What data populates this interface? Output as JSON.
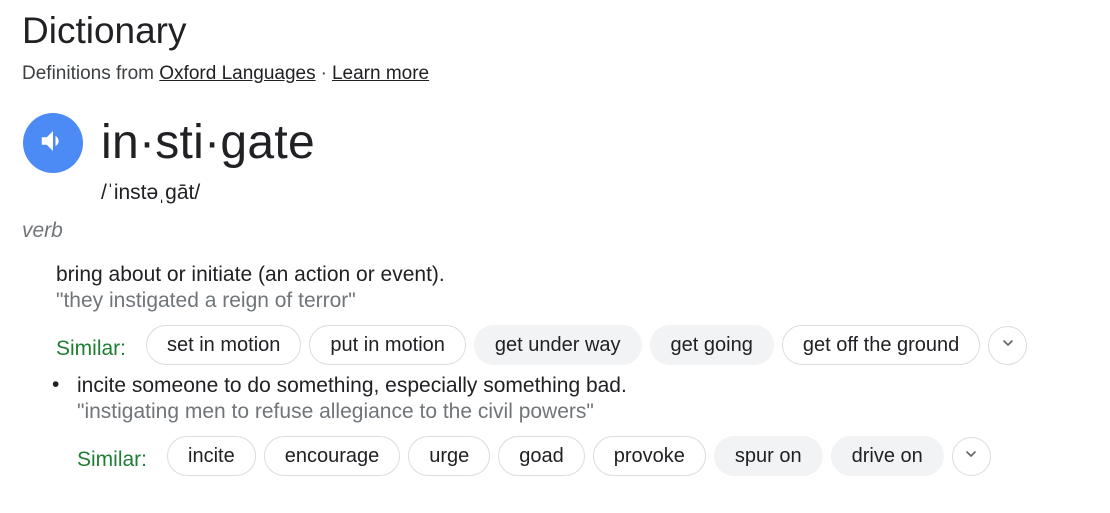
{
  "header": {
    "title": "Dictionary",
    "source_prefix": "Definitions from",
    "source_link": "Oxford Languages",
    "separator": "·",
    "learn_more": "Learn more"
  },
  "entry": {
    "word": "in·sti·gate",
    "phonetic": "/ˈinstəˌɡāt/",
    "part_of_speech": "verb"
  },
  "definitions": [
    {
      "definition": "bring about or initiate (an action or event).",
      "example": "\"they instigated a reign of terror\"",
      "similar_label": "Similar:",
      "similar": [
        {
          "label": "set in motion",
          "style": "outlined"
        },
        {
          "label": "put in motion",
          "style": "outlined"
        },
        {
          "label": "get under way",
          "style": "filled"
        },
        {
          "label": "get going",
          "style": "filled"
        },
        {
          "label": "get off the ground",
          "style": "outlined"
        }
      ]
    },
    {
      "bullet": "•",
      "definition": "incite someone to do something, especially something bad.",
      "example": "\"instigating men to refuse allegiance to the civil powers\"",
      "similar_label": "Similar:",
      "similar": [
        {
          "label": "incite",
          "style": "outlined"
        },
        {
          "label": "encourage",
          "style": "outlined"
        },
        {
          "label": "urge",
          "style": "outlined"
        },
        {
          "label": "goad",
          "style": "outlined"
        },
        {
          "label": "provoke",
          "style": "outlined"
        },
        {
          "label": "spur on",
          "style": "filled"
        },
        {
          "label": "drive on",
          "style": "filled"
        }
      ]
    }
  ],
  "icons": {
    "speaker": "speaker-icon",
    "expand": "chevron-down-icon"
  },
  "colors": {
    "speaker_bg": "#4c8bf5",
    "similar_label": "#1e7e34",
    "example_text": "#70757a",
    "chip_filled_bg": "#f1f3f4"
  }
}
